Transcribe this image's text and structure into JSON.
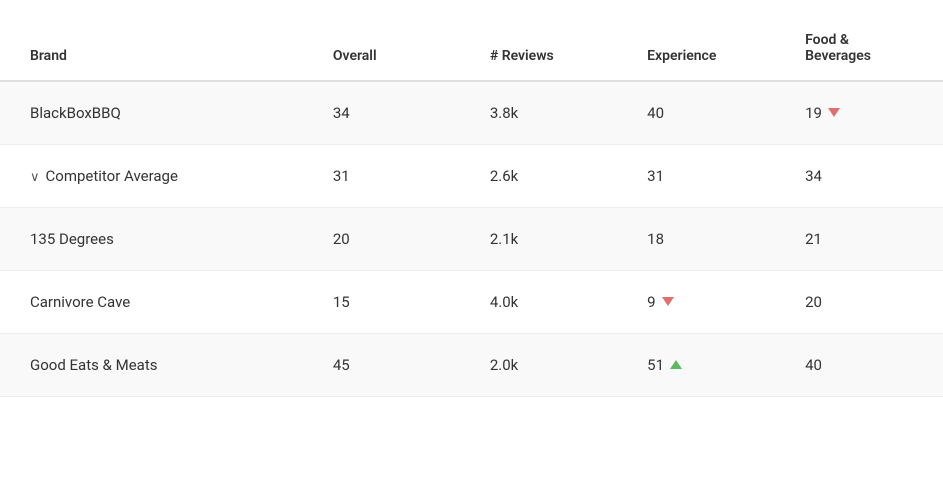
{
  "table": {
    "headers": [
      {
        "key": "brand",
        "label": "Brand"
      },
      {
        "key": "overall",
        "label": "Overall"
      },
      {
        "key": "reviews",
        "label": "# Reviews"
      },
      {
        "key": "experience",
        "label": "Experience"
      },
      {
        "key": "food_beverages",
        "label": "Food &\nBeverages"
      }
    ],
    "rows": [
      {
        "id": "blackboxbbq",
        "brand": "BlackBoxBBQ",
        "isCompetitorAverage": false,
        "overall": "34",
        "reviews": "3.8k",
        "experience": "40",
        "experience_indicator": "none",
        "food_beverages": "19",
        "food_indicator": "down"
      },
      {
        "id": "competitor-average",
        "brand": "Competitor Average",
        "isCompetitorAverage": true,
        "overall": "31",
        "reviews": "2.6k",
        "experience": "31",
        "experience_indicator": "none",
        "food_beverages": "34",
        "food_indicator": "none"
      },
      {
        "id": "135-degrees",
        "brand": "135 Degrees",
        "isCompetitorAverage": false,
        "overall": "20",
        "reviews": "2.1k",
        "experience": "18",
        "experience_indicator": "none",
        "food_beverages": "21",
        "food_indicator": "none"
      },
      {
        "id": "carnivore-cave",
        "brand": "Carnivore Cave",
        "isCompetitorAverage": false,
        "overall": "15",
        "reviews": "4.0k",
        "experience": "9",
        "experience_indicator": "down",
        "food_beverages": "20",
        "food_indicator": "none"
      },
      {
        "id": "good-eats-meats",
        "brand": "Good Eats & Meats",
        "isCompetitorAverage": false,
        "overall": "45",
        "reviews": "2.0k",
        "experience": "51",
        "experience_indicator": "up",
        "food_beverages": "40",
        "food_indicator": "none"
      }
    ]
  }
}
